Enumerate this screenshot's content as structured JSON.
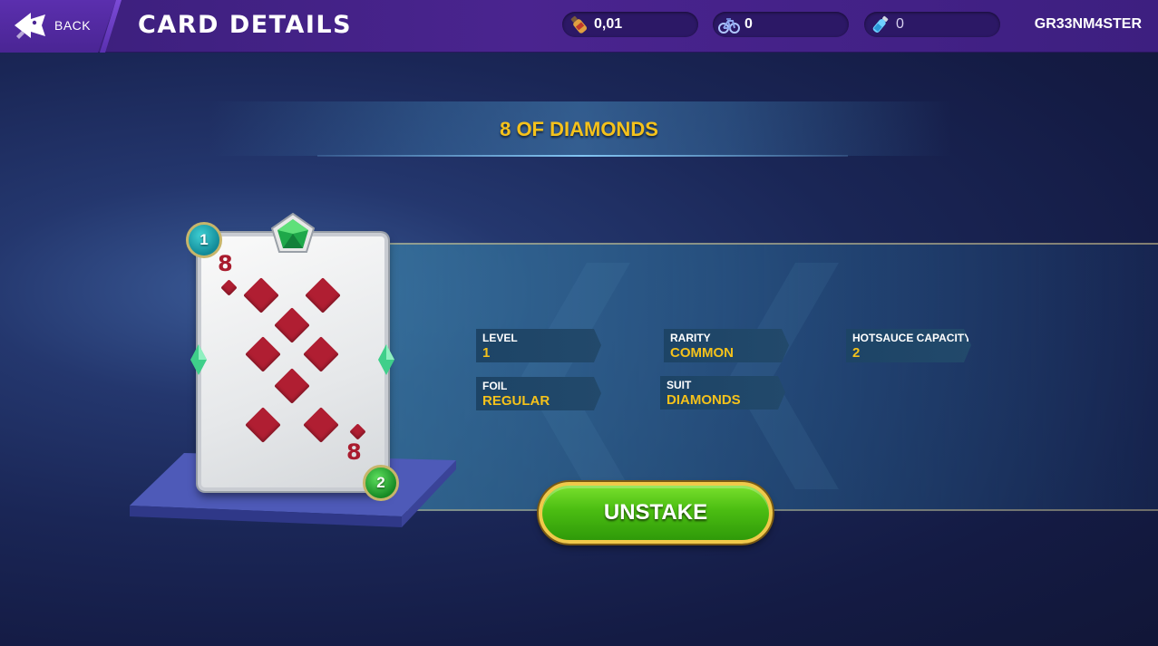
{
  "header": {
    "back_label": "BACK",
    "title": "CARD DETAILS",
    "stats": [
      {
        "icon": "hotsauce-bottle-icon",
        "value": "0,01"
      },
      {
        "icon": "bicycle-icon",
        "value": "0"
      },
      {
        "icon": "potion-icon",
        "value": "0"
      }
    ],
    "username": "GR33NM4STER"
  },
  "card": {
    "name": "8 OF DIAMONDS",
    "rank": "8",
    "suit_color": "#b01e32",
    "level_badge": "1",
    "second_badge": "2",
    "gem": "emerald-icon"
  },
  "details": {
    "level": {
      "label": "LEVEL",
      "value": "1"
    },
    "rarity": {
      "label": "RARITY",
      "value": "COMMON"
    },
    "hotsauce_capacity": {
      "label": "HOTSAUCE CAPACITY",
      "value": "2"
    },
    "foil": {
      "label": "FOIL",
      "value": "REGULAR"
    },
    "suit": {
      "label": "SUIT",
      "value": "DIAMONDS"
    }
  },
  "actions": {
    "unstake_label": "UNSTAKE"
  },
  "colors": {
    "accent_gold": "#f5c21b",
    "button_green": "#4bbd12",
    "topbar_purple": "#4a248f"
  }
}
